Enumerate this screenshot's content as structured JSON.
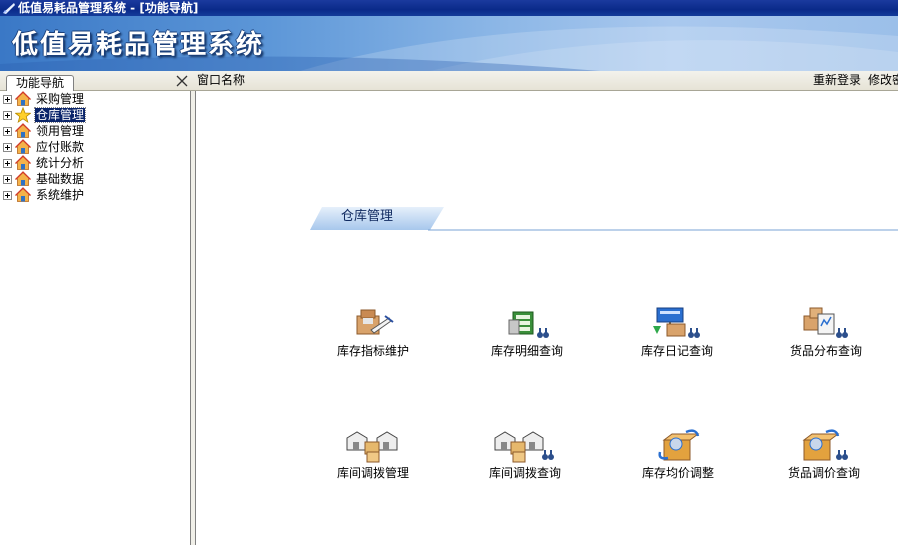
{
  "window": {
    "title": "低值易耗品管理系统 - [功能导航]"
  },
  "banner": {
    "title": "低值易耗品管理系统"
  },
  "nav": {
    "tab_label": "功能导航",
    "items": [
      {
        "label": "采购管理",
        "icon": "house-icon"
      },
      {
        "label": "仓库管理",
        "icon": "star-icon",
        "selected": true
      },
      {
        "label": "领用管理",
        "icon": "house-icon"
      },
      {
        "label": "应付账款",
        "icon": "house-icon"
      },
      {
        "label": "统计分析",
        "icon": "house-icon"
      },
      {
        "label": "基础数据",
        "icon": "house-icon"
      },
      {
        "label": "系统维护",
        "icon": "house-icon"
      }
    ]
  },
  "header": {
    "window_name": "窗口名称",
    "relogin": "重新登录",
    "change_password": "修改密码"
  },
  "section": {
    "title": "仓库管理"
  },
  "tiles": [
    {
      "label": "库存指标维护",
      "icon": "inventory-edit-icon"
    },
    {
      "label": "库存明细查询",
      "icon": "inventory-detail-search-icon"
    },
    {
      "label": "库存日记查询",
      "icon": "inventory-journal-search-icon"
    },
    {
      "label": "货品分布查询",
      "icon": "goods-distribution-search-icon"
    },
    {
      "label": "库间调拨管理",
      "icon": "warehouse-transfer-icon"
    },
    {
      "label": "库间调拨查询",
      "icon": "warehouse-transfer-search-icon"
    },
    {
      "label": "库存均价调整",
      "icon": "average-price-adjust-icon"
    },
    {
      "label": "货品调价查询",
      "icon": "price-adjust-search-icon"
    }
  ],
  "colors": {
    "titlebar": "#0a2a8a",
    "banner": "#5d97d8",
    "selection": "#0a246a"
  }
}
